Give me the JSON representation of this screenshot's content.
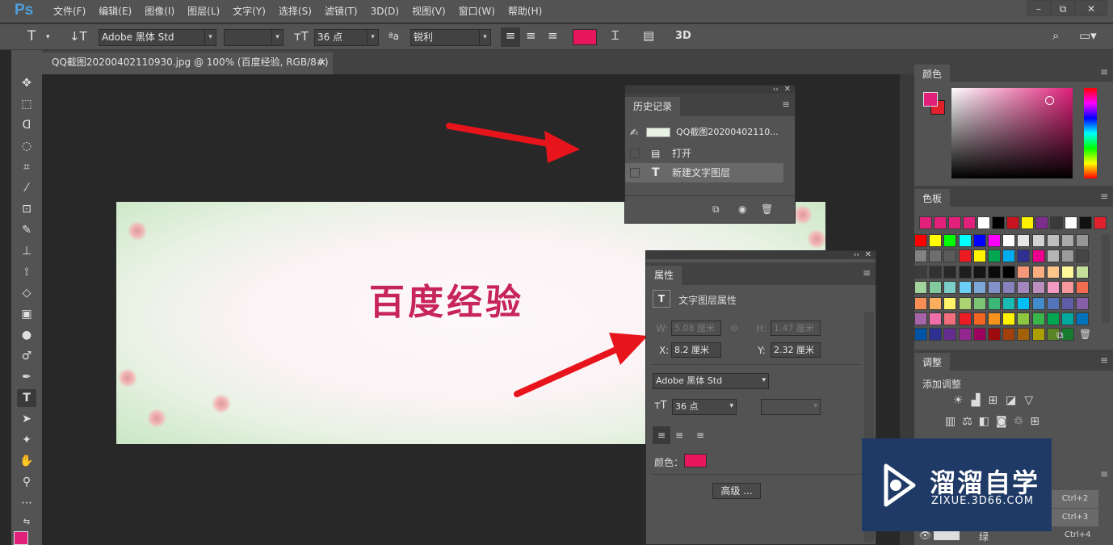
{
  "app": {
    "logo": "Ps"
  },
  "menu": {
    "items": [
      "文件(F)",
      "编辑(E)",
      "图像(I)",
      "图层(L)",
      "文字(Y)",
      "选择(S)",
      "滤镜(T)",
      "3D(D)",
      "视图(V)",
      "窗口(W)",
      "帮助(H)"
    ]
  },
  "window_controls": {
    "minimize": "–",
    "restore": "⧉",
    "close": "✕"
  },
  "options": {
    "font_family": "Adobe 黑体 Std",
    "font_style": "",
    "font_size": "36 点",
    "aa_label": "ªa",
    "antialias": "锐利",
    "three_d": "3D",
    "text_color": "#e8175d"
  },
  "document": {
    "tab_title": "QQ截图20200402110930.jpg @ 100% (百度经验, RGB/8#) *",
    "close": "×",
    "image_text": "百度经验"
  },
  "history": {
    "title": "历史记录",
    "snapshot": "QQ截图20200402110...",
    "items": [
      "打开",
      "新建文字图层"
    ]
  },
  "properties": {
    "title": "属性",
    "section": "文字图层属性",
    "w_label": "W:",
    "w_value": "5.08 厘米",
    "h_label": "H:",
    "h_value": "1.47 厘米",
    "x_label": "X:",
    "x_value": "8.2 厘米",
    "y_label": "Y:",
    "y_value": "2.32 厘米",
    "font_family": "Adobe 黑体 Std",
    "font_size": "36 点",
    "color_label": "颜色：",
    "advanced": "高级 ...",
    "text_color": "#e8175d"
  },
  "color_panel": {
    "title": "颜色",
    "fg": "#e0207a",
    "bg": "#e0202c"
  },
  "swatches_panel": {
    "title": "色板"
  },
  "adjustments_panel": {
    "title": "调整",
    "add_label": "添加调整"
  },
  "layers": {
    "rows": [
      {
        "shortcut": "Ctrl+2"
      },
      {
        "shortcut": "Ctrl+3"
      },
      {
        "name": "绿",
        "shortcut": "Ctrl+4"
      }
    ]
  },
  "watermark": {
    "title": "溜溜自学",
    "subtitle": "ZIXUE.3D66.COM"
  },
  "colors": {
    "accent": "#e8175d",
    "panel": "#535353",
    "canvas": "#282828"
  }
}
